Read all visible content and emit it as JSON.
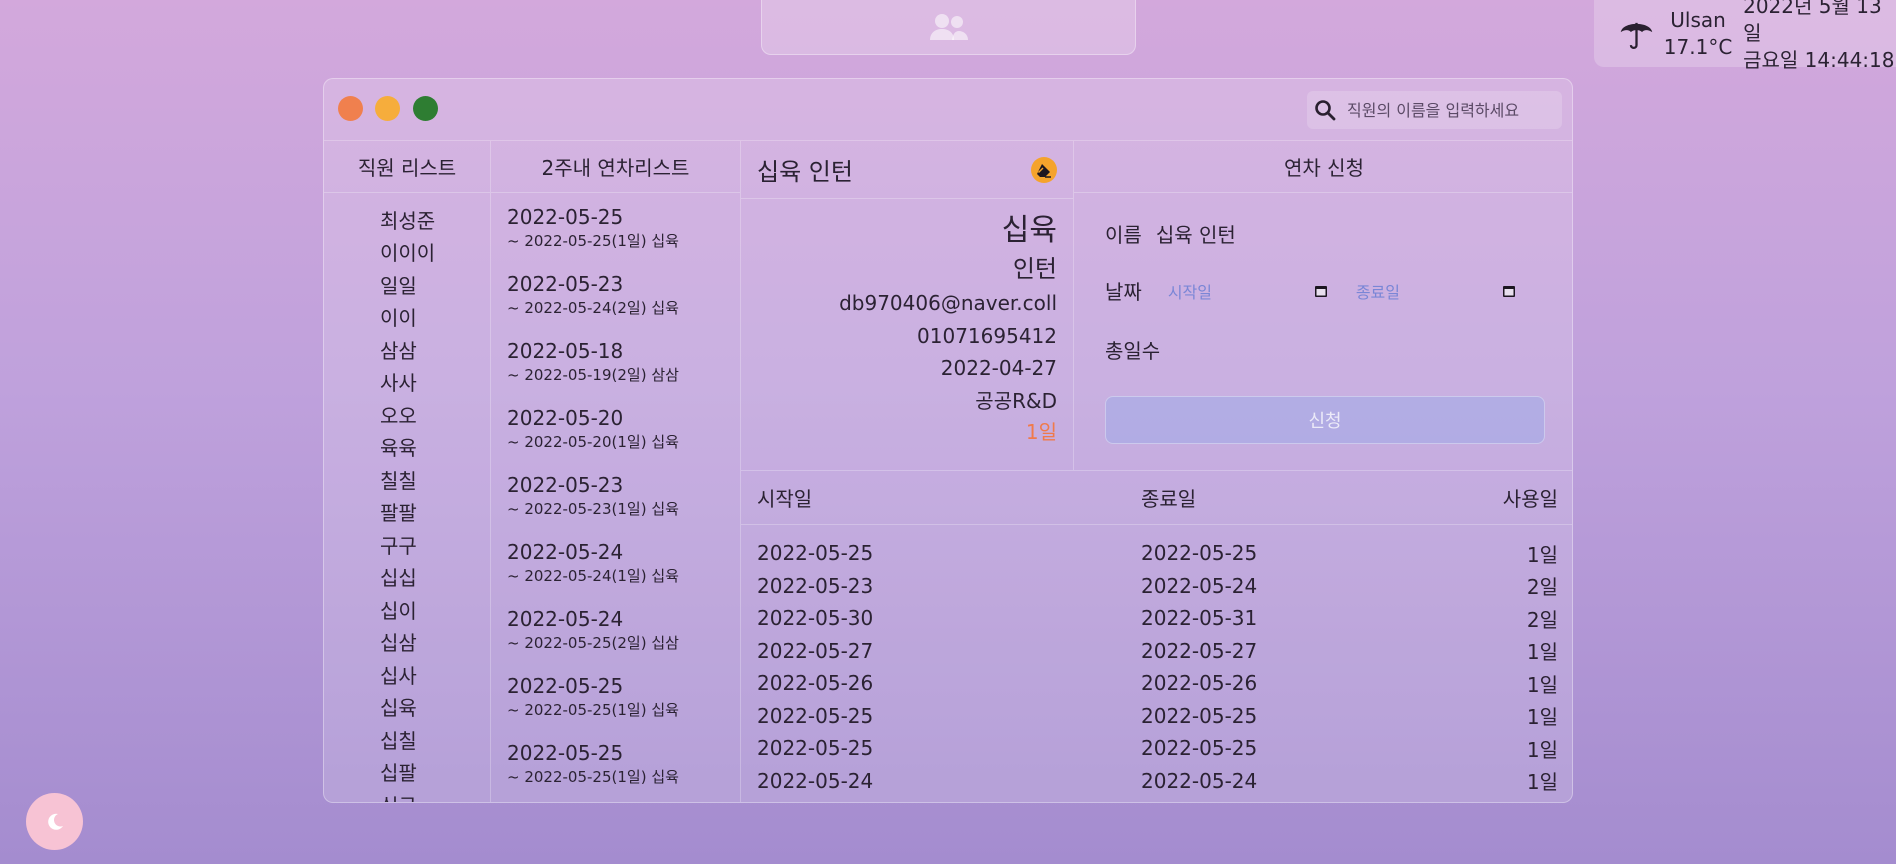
{
  "weather": {
    "city": "Ulsan",
    "temperature": "17.1°C",
    "date": "2022년 5월 13일",
    "time": "금요일 14:44:18"
  },
  "search": {
    "placeholder": "직원의 이름을 입력하세요"
  },
  "employees": {
    "header": "직원 리스트",
    "items": [
      "최성준",
      "이이이",
      "일일",
      "이이",
      "삼삼",
      "사사",
      "오오",
      "육육",
      "칠칠",
      "팔팔",
      "구구",
      "십십",
      "십이",
      "십삼",
      "십사",
      "십육",
      "십칠",
      "십팔",
      "십구"
    ]
  },
  "recent": {
    "header": "2주내 연차리스트",
    "items": [
      {
        "start": "2022-05-25",
        "sub": "~ 2022-05-25(1일) 십육"
      },
      {
        "start": "2022-05-23",
        "sub": "~ 2022-05-24(2일) 십육"
      },
      {
        "start": "2022-05-18",
        "sub": "~ 2022-05-19(2일) 삼삼"
      },
      {
        "start": "2022-05-20",
        "sub": "~ 2022-05-20(1일) 십육"
      },
      {
        "start": "2022-05-23",
        "sub": "~ 2022-05-23(1일) 십육"
      },
      {
        "start": "2022-05-24",
        "sub": "~ 2022-05-24(1일) 십육"
      },
      {
        "start": "2022-05-24",
        "sub": "~ 2022-05-25(2일) 십삼"
      },
      {
        "start": "2022-05-25",
        "sub": "~ 2022-05-25(1일) 십육"
      },
      {
        "start": "2022-05-25",
        "sub": "~ 2022-05-25(1일) 십육"
      }
    ]
  },
  "detail": {
    "title": "십육 인턴",
    "name": "십육",
    "rank": "인턴",
    "email": "db970406@naver.coll",
    "phone": "01071695412",
    "join_date": "2022-04-27",
    "department": "공공R&D",
    "remaining": "1일"
  },
  "apply": {
    "header": "연차 신청",
    "name_label": "이름",
    "name_value": "십육 인턴",
    "date_label": "날짜",
    "start_placeholder": "시작일",
    "end_placeholder": "종료일",
    "total_label": "총일수",
    "submit_label": "신청"
  },
  "history": {
    "columns": [
      "시작일",
      "종료일",
      "사용일"
    ],
    "rows": [
      [
        "2022-05-25",
        "2022-05-25",
        "1일"
      ],
      [
        "2022-05-23",
        "2022-05-24",
        "2일"
      ],
      [
        "2022-05-30",
        "2022-05-31",
        "2일"
      ],
      [
        "2022-05-27",
        "2022-05-27",
        "1일"
      ],
      [
        "2022-05-26",
        "2022-05-26",
        "1일"
      ],
      [
        "2022-05-25",
        "2022-05-25",
        "1일"
      ],
      [
        "2022-05-25",
        "2022-05-25",
        "1일"
      ],
      [
        "2022-05-24",
        "2022-05-24",
        "1일"
      ]
    ]
  },
  "colors": {
    "accent": "#f5a32c",
    "remaining": "#f07a4a",
    "traffic_red": "#f0804e",
    "traffic_yellow": "#f6ad3c",
    "traffic_green": "#2e7d32"
  },
  "icons": {
    "dock": "users-icon",
    "weather": "umbrella-icon",
    "search": "search-icon",
    "edit": "eraser-icon",
    "theme": "moon-icon",
    "calendar": "calendar-icon"
  }
}
